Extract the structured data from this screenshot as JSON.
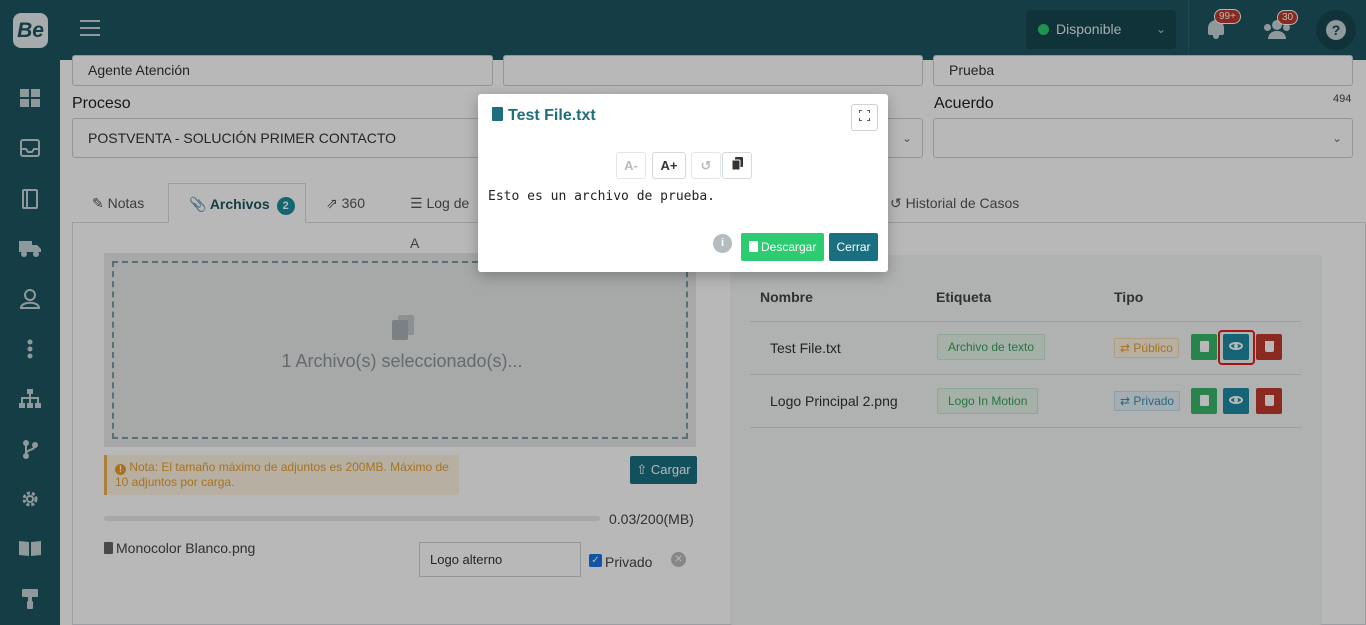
{
  "topbar": {
    "logo_text": "Be",
    "status": {
      "label": "Disponible",
      "color": "#2ecc71"
    },
    "notifications_badge": "99+",
    "users_badge": "30",
    "help_icon": "?"
  },
  "sidebar": {
    "items": [
      "dashboard-icon",
      "inbox-icon",
      "book-icon",
      "truck-icon",
      "user-icon",
      "more-vertical-icon",
      "sitemap-icon",
      "branch-icon",
      "settings-icon",
      "book-open-icon",
      "paint-roller-icon"
    ]
  },
  "form": {
    "agent_value": "Agente Atención",
    "empty_value": "",
    "prueba_value": "Prueba",
    "proceso_label": "Proceso",
    "proceso_value": "POSTVENTA - SOLUCIÓN PRIMER CONTACTO",
    "acuerdo_label": "Acuerdo",
    "acuerdo_value": "",
    "char_counter": "494"
  },
  "tabs": {
    "notas": "Notas",
    "archivos": "Archivos",
    "archivos_count": "2",
    "t360": "360",
    "log": "Log de A",
    "historial": "Historial de Casos"
  },
  "upload": {
    "dropzone_text": "1 Archivo(s) seleccionado(s)...",
    "note": "Nota: El tamaño máximo de adjuntos es 200MB. Máximo de 10 adjuntos por carga.",
    "upload_button": "Cargar",
    "progress_label": "0.03/200(MB)",
    "selected_file": "Monocolor Blanco.png",
    "tag_value": "Logo alterno",
    "private_label": "Privado",
    "private_checked": true
  },
  "files_table": {
    "headers": [
      "Nombre",
      "Etiqueta",
      "Tipo"
    ],
    "rows": [
      {
        "name": "Test File.txt",
        "tag": "Archivo de texto",
        "type": "Público"
      },
      {
        "name": "Logo Principal 2.png",
        "tag": "Logo In Motion",
        "type": "Privado"
      }
    ]
  },
  "modal": {
    "title": "Test File.txt",
    "font_decrease": "A-",
    "font_increase": "A+",
    "content": "Esto es un archivo de prueba.",
    "download_button": "Descargar",
    "close_button": "Cerrar"
  }
}
